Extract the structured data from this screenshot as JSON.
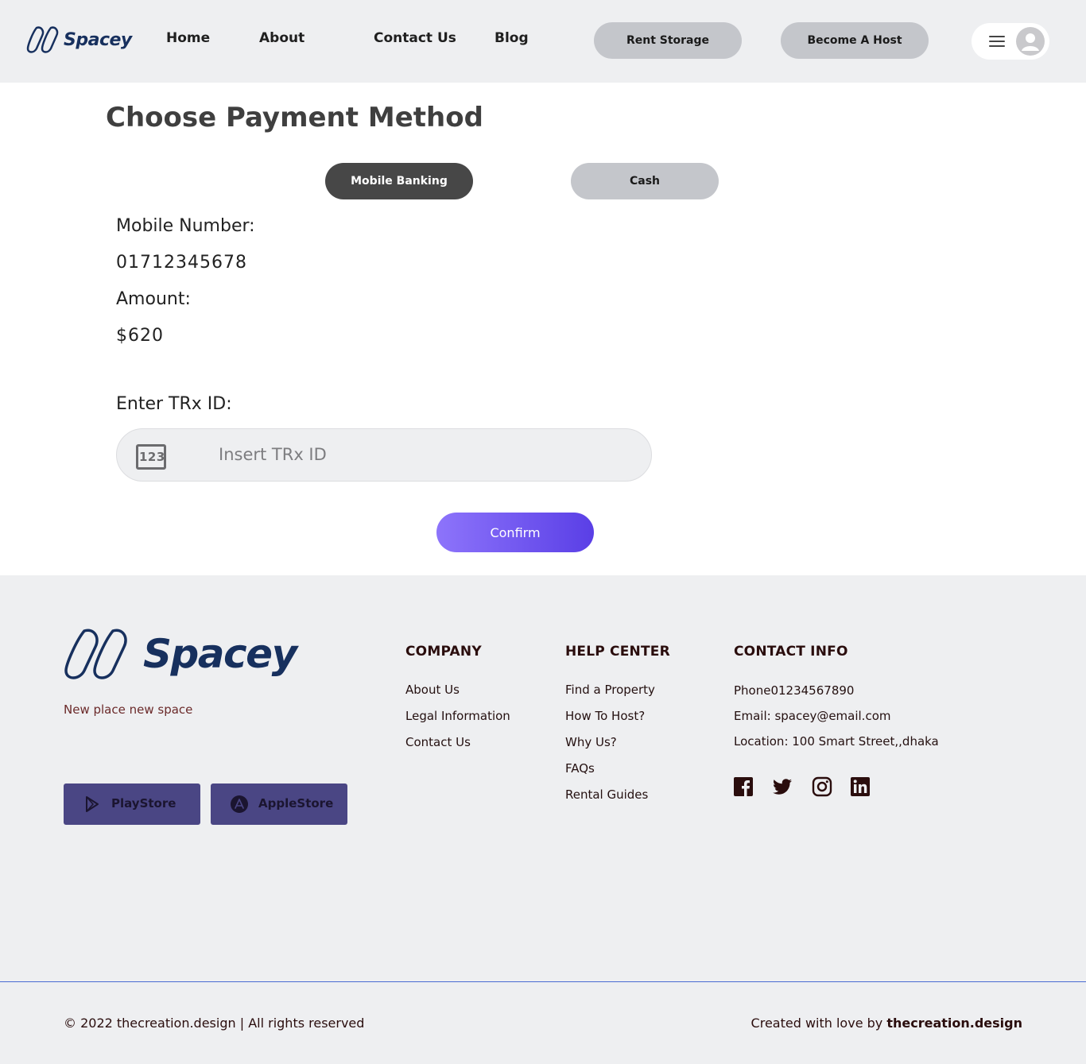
{
  "header": {
    "logo_text": "Spacey",
    "nav": [
      {
        "label": "Home"
      },
      {
        "label": "About"
      },
      {
        "label": "Contact Us"
      },
      {
        "label": "Blog"
      }
    ],
    "rent_storage_label": "Rent Storage",
    "become_host_label": "Become A Host",
    "menu_icon": "hamburger-icon",
    "avatar_icon": "user-avatar-icon"
  },
  "main": {
    "title": "Choose Payment Method",
    "tabs": [
      {
        "label": "Mobile Banking",
        "active": true
      },
      {
        "label": "Cash",
        "active": false
      }
    ],
    "mobile_number_label": "Mobile Number:",
    "mobile_number_value": "01712345678",
    "amount_label": "Amount:",
    "amount_value": "$620",
    "trx_label": "Enter TRx ID:",
    "trx_placeholder": "Insert TRx ID",
    "trx_icon_text": "123",
    "confirm_label": "Confirm"
  },
  "footer": {
    "logo_text": "Spacey",
    "tagline": "New place new  space",
    "playstore_label": "PlayStore",
    "applestore_label": "AppleStore",
    "company": {
      "title": "COMPANY",
      "links": [
        "About Us",
        "Legal Information",
        "Contact Us"
      ]
    },
    "help": {
      "title": "HELP CENTER",
      "links": [
        "Find a Property",
        "How To Host?",
        "Why Us?",
        "FAQs",
        "Rental Guides"
      ]
    },
    "contact": {
      "title": "CONTACT INFO",
      "phone": "Phone01234567890",
      "email": "Email: spacey@email.com",
      "location": "Location: 100 Smart Street,,dhaka"
    },
    "social_icons": [
      "facebook-icon",
      "twitter-icon",
      "instagram-icon",
      "linkedin-icon"
    ],
    "copyright": "© 2022 thecreation.design | All rights reserved",
    "credit_prefix": "Created with love by ",
    "credit_brand": "thecreation.design"
  },
  "colors": {
    "header_bg": "#eeeff1",
    "brand_navy": "#17305e",
    "confirm_gradient_start": "#8d74fb",
    "confirm_gradient_end": "#5a3fe6",
    "store_button_bg": "#4a4684",
    "active_tab_bg": "#474747"
  }
}
